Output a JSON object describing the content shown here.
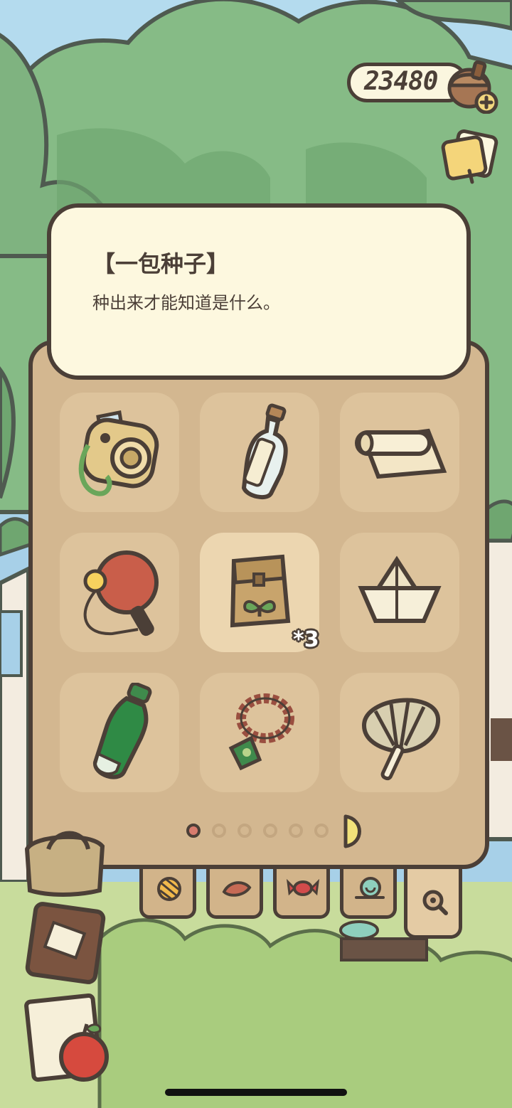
{
  "hud": {
    "clover_count": "23480",
    "acorn_icon": "acorn-icon",
    "add_icon": "plus-icon",
    "notes_icon": "notes-icon"
  },
  "item_detail": {
    "title": "【一包种子】",
    "description": "种出来才能知道是什么。"
  },
  "inventory": {
    "items": [
      {
        "name": "instant-camera",
        "icon": "camera-icon"
      },
      {
        "name": "message-bottle",
        "icon": "bottle-icon"
      },
      {
        "name": "paper-roll",
        "icon": "scroll-icon"
      },
      {
        "name": "ping-pong-paddle",
        "icon": "paddle-icon"
      },
      {
        "name": "seed-pack",
        "icon": "seed-bag-icon",
        "count": "*3",
        "selected": true
      },
      {
        "name": "paper-boat",
        "icon": "paper-boat-icon"
      },
      {
        "name": "soda-bottle",
        "icon": "soda-bottle-icon"
      },
      {
        "name": "prayer-beads-charm",
        "icon": "charm-icon"
      },
      {
        "name": "feather-fan",
        "icon": "fan-icon"
      }
    ],
    "page_total": 6,
    "page_current": 1
  },
  "tabs": [
    {
      "name": "yarn",
      "icon": "yarn-icon"
    },
    {
      "name": "leaf",
      "icon": "leaf-icon"
    },
    {
      "name": "candy",
      "icon": "candy-icon"
    },
    {
      "name": "snail",
      "icon": "snail-icon"
    },
    {
      "name": "search",
      "icon": "search-icon"
    }
  ],
  "colors": {
    "outline": "#4b3f37",
    "panel": "#d3b790",
    "slot": "#ddc39c",
    "dialog": "#fdf8df",
    "active_dot": "#d77c6e"
  }
}
